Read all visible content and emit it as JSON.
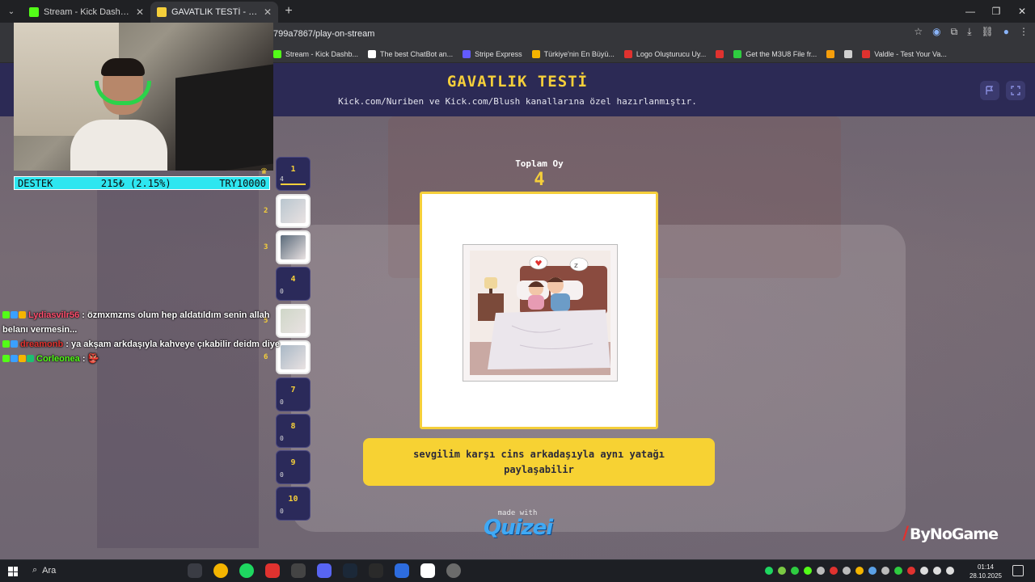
{
  "browser": {
    "tabs": [
      {
        "title": "Stream - Kick Dashboard",
        "active": false,
        "favicon_color": "#53fc18"
      },
      {
        "title": "GAVATLIK TESTİ - Quizei",
        "active": true,
        "favicon_color": "#f5cf3a"
      }
    ],
    "new_tab_label": "+",
    "url": "799a7867/play-on-stream",
    "bookmarks": [
      {
        "label": "Stream - Kick Dashb...",
        "color": "#53fc18"
      },
      {
        "label": "The best ChatBot an...",
        "color": "#ffffff"
      },
      {
        "label": "Stripe Express",
        "color": "#635bff"
      },
      {
        "label": "Türkiye'nin En Büyü...",
        "color": "#f5b400"
      },
      {
        "label": "Logo Oluşturucu Uy...",
        "color": "#e0322f"
      },
      {
        "label": "",
        "color": "#e0322f"
      },
      {
        "label": "Get the M3U8 File fr...",
        "color": "#2ecc40"
      },
      {
        "label": "",
        "color": "#f59e0b"
      },
      {
        "label": "",
        "color": "#cfcfcf"
      },
      {
        "label": "Valdle - Test Your Va...",
        "color": "#e0322f"
      }
    ]
  },
  "quiz": {
    "title": "GAVATLIK TESTİ",
    "subtitle": "Kick.com/Nuriben ve Kick.com/Blush kanallarına özel hazırlanmıştır.",
    "total_votes_label": "Toplam Oy",
    "total_votes": "4",
    "answer_text": "sevgilim karşı cins arkadaşıyla aynı yatağı paylaşabilir",
    "questions": [
      {
        "num": "1",
        "count": "4",
        "type": "active"
      },
      {
        "num": "2",
        "count": "",
        "type": "thumb"
      },
      {
        "num": "3",
        "count": "",
        "type": "thumb"
      },
      {
        "num": "4",
        "count": "0",
        "type": "plain"
      },
      {
        "num": "5",
        "count": "",
        "type": "thumb"
      },
      {
        "num": "6",
        "count": "",
        "type": "thumb"
      },
      {
        "num": "7",
        "count": "0",
        "type": "plain"
      },
      {
        "num": "8",
        "count": "0",
        "type": "plain"
      },
      {
        "num": "9",
        "count": "0",
        "type": "plain"
      },
      {
        "num": "10",
        "count": "0",
        "type": "plain"
      }
    ],
    "made_with": "made with",
    "brand_logo": "Quizei",
    "sponsor_logo": "ByNoGame",
    "accent_color": "#f5cf3a",
    "header_color": "#2c2a55"
  },
  "stream": {
    "donation": {
      "label": "DESTEK",
      "progress": "215₺ (2.15%)",
      "goal": "TRY10000",
      "progress_fraction": 0.0215
    },
    "chat": [
      {
        "user": "Lydiasvilr56",
        "user_color": "#ff4d6d",
        "message": ": özmxmzms olum hep aldatıldım senin allah belanı vermesin..."
      },
      {
        "user": "dreamonb",
        "user_color": "#e0322f",
        "message": ": ya akşam arkdaşıyla kahveye çıkabilir deidm diye"
      },
      {
        "user": "Corleonea",
        "user_color": "#53fc18",
        "message": ": 👺"
      }
    ]
  },
  "taskbar": {
    "search_label": "Ara",
    "time": "01:14",
    "date": "28.10.2025"
  }
}
